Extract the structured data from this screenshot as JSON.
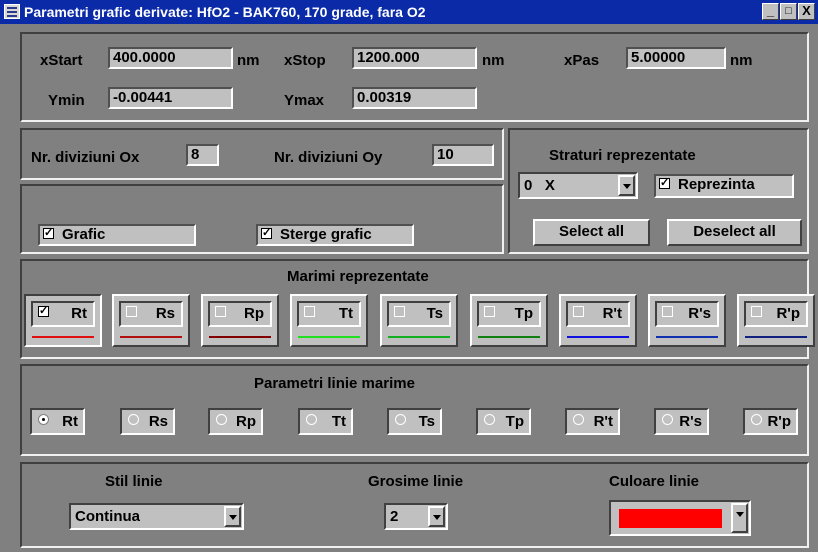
{
  "window": {
    "title": "Parametri grafic derivate:  HfO2 - BAK760, 170 grade, fara O2",
    "minimize": "_",
    "maximize": "□",
    "close": "X"
  },
  "range": {
    "xstart_label": "xStart",
    "xstart_value": "400.0000",
    "xstart_unit": "nm",
    "xstop_label": "xStop",
    "xstop_value": "1200.000",
    "xstop_unit": "nm",
    "xpas_label": "xPas",
    "xpas_value": "5.00000",
    "xpas_unit": "nm",
    "ymin_label": "Ymin",
    "ymin_value": "-0.00441",
    "ymax_label": "Ymax",
    "ymax_value": "0.00319"
  },
  "divisions": {
    "ox_label": "Nr. diviziuni Ox",
    "ox_value": "8",
    "oy_label": "Nr. diviziuni Oy",
    "oy_value": "10"
  },
  "graph": {
    "grafic_label": "Grafic",
    "grafic_checked": true,
    "sterge_label": "Sterge grafic",
    "sterge_checked": true
  },
  "layers": {
    "title": "Straturi reprezentate",
    "layer_value": "0   X",
    "reprezinta_label": "Reprezinta",
    "reprezinta_checked": true,
    "select_all": "Select all",
    "deselect_all": "Deselect all"
  },
  "quantities": {
    "title": "Marimi reprezentate",
    "items": [
      {
        "label": "Rt",
        "checked": true,
        "color": "#e01010"
      },
      {
        "label": "Rs",
        "checked": false,
        "color": "#b01010"
      },
      {
        "label": "Rp",
        "checked": false,
        "color": "#800000"
      },
      {
        "label": "Tt",
        "checked": false,
        "color": "#20e020"
      },
      {
        "label": "Ts",
        "checked": false,
        "color": "#10b020"
      },
      {
        "label": "Tp",
        "checked": false,
        "color": "#108010"
      },
      {
        "label": "R't",
        "checked": false,
        "color": "#1010e0"
      },
      {
        "label": "R's",
        "checked": false,
        "color": "#1030b0"
      },
      {
        "label": "R'p",
        "checked": false,
        "color": "#102080"
      }
    ]
  },
  "line_params": {
    "title": "Parametri linie marime",
    "selected": "Rt",
    "items": [
      "Rt",
      "Rs",
      "Rp",
      "Tt",
      "Ts",
      "Tp",
      "R't",
      "R's",
      "R'p"
    ]
  },
  "line_style": {
    "stil_label": "Stil linie",
    "stil_value": "Continua",
    "grosime_label": "Grosime linie",
    "grosime_value": "2",
    "culoare_label": "Culoare linie",
    "culoare_value": "#ff0000"
  }
}
